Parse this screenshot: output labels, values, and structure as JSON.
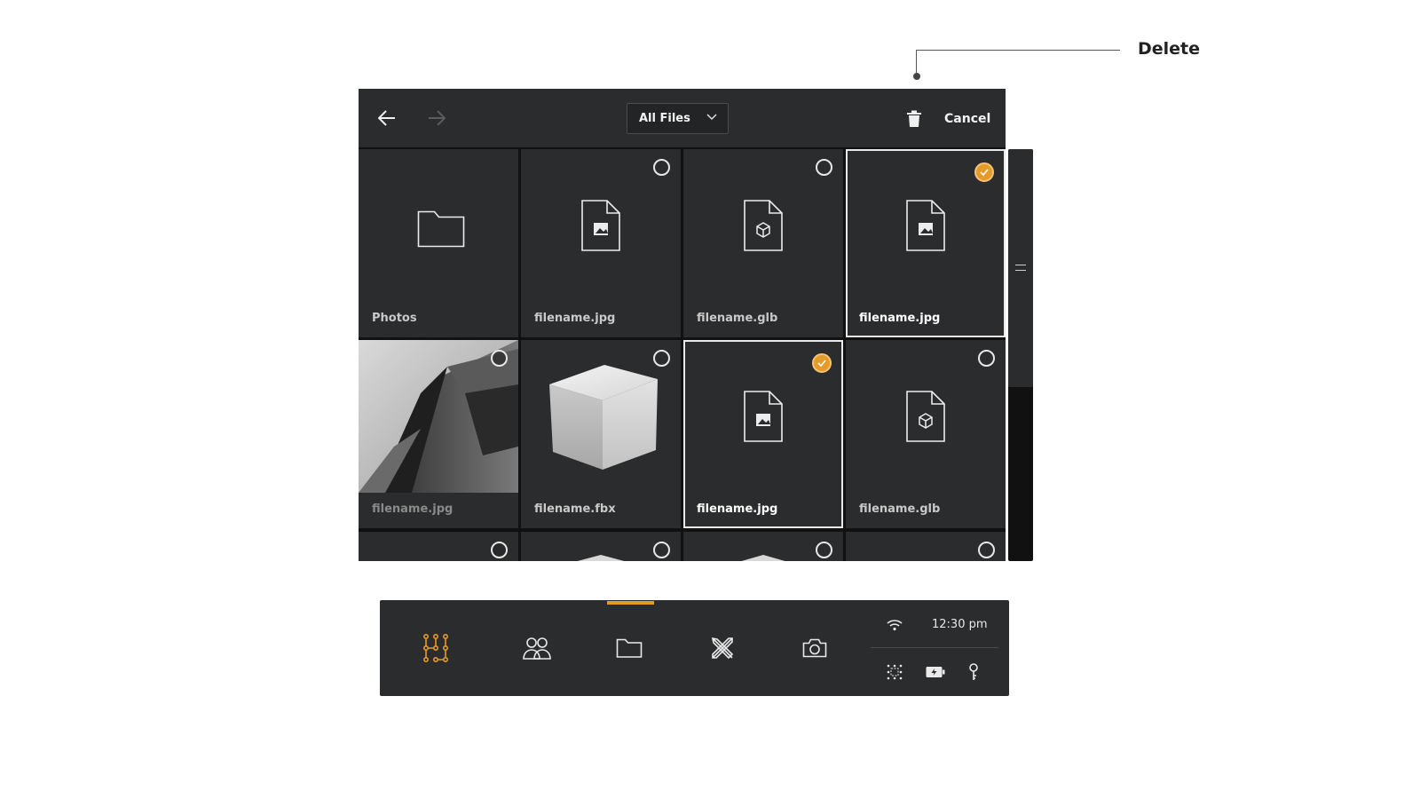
{
  "annotation": {
    "label": "Delete"
  },
  "toolbar": {
    "back_icon": "arrow-left-icon",
    "forward_icon": "arrow-right-icon",
    "filter": {
      "selected": "All Files",
      "icon": "chevron-down-icon"
    },
    "delete_icon": "trash-icon",
    "cancel_label": "Cancel"
  },
  "files": [
    {
      "label": "Photos",
      "kind": "folder",
      "selected": false
    },
    {
      "label": "filename.jpg",
      "kind": "image-doc",
      "selected": false
    },
    {
      "label": "filename.glb",
      "kind": "3d-doc",
      "selected": false
    },
    {
      "label": "filename.jpg",
      "kind": "image-doc",
      "selected": true
    },
    {
      "label": "filename.jpg",
      "kind": "photo-thumbnail",
      "selected": false
    },
    {
      "label": "filename.fbx",
      "kind": "cube-thumbnail",
      "selected": false
    },
    {
      "label": "filename.jpg",
      "kind": "image-doc",
      "selected": true
    },
    {
      "label": "filename.glb",
      "kind": "3d-doc",
      "selected": false
    }
  ],
  "dock": {
    "items": [
      {
        "icon": "network-nodes-icon",
        "active": false
      },
      {
        "icon": "people-icon",
        "active": false
      },
      {
        "icon": "folder-icon",
        "active": true
      },
      {
        "icon": "tools-icon",
        "active": false
      },
      {
        "icon": "camera-icon",
        "active": false
      }
    ],
    "status": {
      "time": "12:30 pm",
      "icons": [
        "wifi-icon",
        "grid-scan-icon",
        "battery-charging-icon",
        "key-icon"
      ]
    }
  },
  "colors": {
    "accent": "#e49b2a",
    "panel": "#2b2c2d",
    "background": "#111111"
  }
}
